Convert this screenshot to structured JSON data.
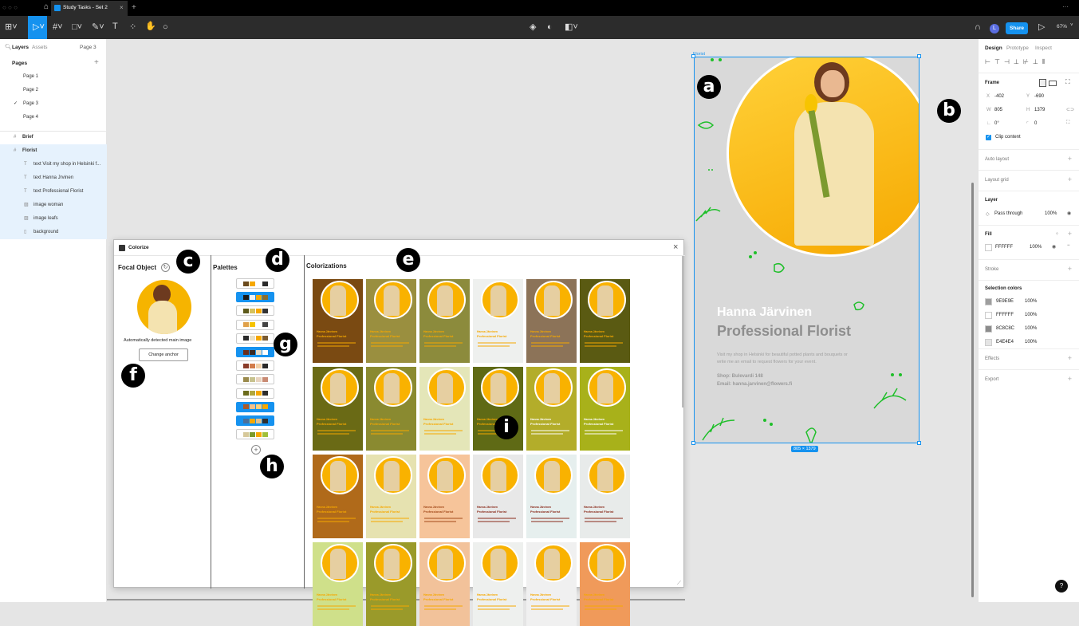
{
  "tabs": {
    "title": "Study Tasks - Set 2",
    "close": "×",
    "add": "+",
    "more": "···"
  },
  "toolbar": {
    "share": "Share",
    "zoom": "67%",
    "avatar": "L"
  },
  "left": {
    "tab_layers": "Layers",
    "tab_assets": "Assets",
    "page_select": "Page 3",
    "pages_title": "Pages",
    "pages": [
      "Page 1",
      "Page 2",
      "Page 3",
      "Page 4"
    ],
    "active_check": "✓",
    "layers": [
      {
        "name": "Brief",
        "icon": "#"
      },
      {
        "name": "Florist",
        "icon": "#"
      },
      {
        "name": "text Visit my shop in Helsinki f...",
        "icon": "T"
      },
      {
        "name": "text Hanna Jrvinen",
        "icon": "T"
      },
      {
        "name": "text Professional Florist",
        "icon": "T"
      },
      {
        "name": "image woman",
        "icon": "▨"
      },
      {
        "name": "image leafs",
        "icon": "▨"
      },
      {
        "name": "background",
        "icon": "▯"
      }
    ]
  },
  "canvas": {
    "frame_label": "Florist",
    "size_label": "805 × 1379",
    "name": "Hanna Järvinen",
    "profession": "Professional Florist",
    "body1": "Visit my shop in Helsinki for beautiful potted plants and bouquets or",
    "body2": "write me an email to request flowers for your event.",
    "shop": "Shop: Bulevardi 148",
    "email": "Email: hanna.jarvinen@flowers.fi"
  },
  "badges": {
    "a": "a",
    "b": "b",
    "c": "c",
    "d": "d",
    "e": "e",
    "f": "f",
    "g": "g",
    "h": "h",
    "i": "i"
  },
  "plugin": {
    "title": "Colorize",
    "close": "×",
    "focal_title": "Focal Object",
    "focal_caption": "Automatically detected main image",
    "change_anchor": "Change anchor",
    "palettes_title": "Palettes",
    "colorizations_title": "Colorizations",
    "add": "+",
    "mini_name": "Hanna Järvinen",
    "mini_prof": "Professional Florist"
  },
  "right": {
    "tab_design": "Design",
    "tab_prototype": "Prototype",
    "tab_inspect": "Inspect",
    "frame": "Frame",
    "x_label": "X",
    "x": "-402",
    "y_label": "Y",
    "y": "-690",
    "w_label": "W",
    "w": "805",
    "h_label": "H",
    "h": "1379",
    "rot": "0°",
    "radius": "0",
    "clip": "Clip content",
    "auto_layout": "Auto layout",
    "layout_grid": "Layout grid",
    "layer": "Layer",
    "pass_through": "Pass through",
    "layer_opacity": "100%",
    "fill": "Fill",
    "fill_hex": "FFFFFF",
    "fill_opacity": "100%",
    "stroke": "Stroke",
    "selection_colors": "Selection colors",
    "sel_colors": [
      {
        "hex": "9E9E9E",
        "op": "100%",
        "color": "#9e9e9e"
      },
      {
        "hex": "FFFFFF",
        "op": "100%",
        "color": "#ffffff"
      },
      {
        "hex": "8C8C8C",
        "op": "100%",
        "color": "#8c8c8c"
      },
      {
        "hex": "E4E4E4",
        "op": "100%",
        "color": "#e4e4e4"
      }
    ],
    "effects": "Effects",
    "export": "Export",
    "help": "?"
  },
  "palettes": [
    {
      "colors": [
        "#6b4a1c",
        "#f6a800",
        "#ffffff",
        "#2b2b2b"
      ],
      "active": false
    },
    {
      "colors": [
        "#1b1b1b",
        "#f2f2f2",
        "#f6a800",
        "#8a6d2f"
      ],
      "active": true
    },
    {
      "colors": [
        "#5d5a1b",
        "#d6c25d",
        "#f6a800",
        "#333333"
      ],
      "active": false
    },
    {
      "colors": [
        "#e0a14a",
        "#f6c300",
        "#ffffff",
        "#444444"
      ],
      "active": false
    },
    {
      "colors": [
        "#2b2b2b",
        "#e8e0c8",
        "#f6a800",
        "#7a5a30"
      ],
      "active": false
    },
    {
      "colors": [
        "#6a2e1c",
        "#3b2a24",
        "#e8dcc8",
        "#ffffff"
      ],
      "active": true
    },
    {
      "colors": [
        "#8b3d2a",
        "#d27c4b",
        "#f2d0a8",
        "#2a2a2a"
      ],
      "active": false
    },
    {
      "colors": [
        "#9a8a4c",
        "#c7c28f",
        "#e8d4c0",
        "#c98b74"
      ],
      "active": false
    },
    {
      "colors": [
        "#6b6b1c",
        "#b1a63c",
        "#f6a800",
        "#2d2d2d"
      ],
      "active": false
    },
    {
      "colors": [
        "#a85a2a",
        "#f3c08a",
        "#ffd07a",
        "#f6a800"
      ],
      "active": true
    },
    {
      "colors": [
        "#4a6f9a",
        "#f6a800",
        "#e3c18a",
        "#2f2f2f"
      ],
      "active": true
    },
    {
      "colors": [
        "#d6c89a",
        "#7a9a2a",
        "#f6a800",
        "#9fbf3a"
      ],
      "active": false
    }
  ],
  "thumbs": [
    {
      "bg": "#7a4a12",
      "t": "#f6a800"
    },
    {
      "bg": "#9a8f3f",
      "t": "#f6a800"
    },
    {
      "bg": "#8c8b3c",
      "t": "#f6a800"
    },
    {
      "bg": "#eef0ee",
      "t": "#f6a800"
    },
    {
      "bg": "#8c7358",
      "t": "#f6a800"
    },
    {
      "bg": "#5a5a12",
      "t": "#f6a800"
    },
    {
      "bg": "#6a6a15",
      "t": "#f6a800"
    },
    {
      "bg": "#8a8a30",
      "t": "#f6a800"
    },
    {
      "bg": "#e4e6b8",
      "t": "#f6a800"
    },
    {
      "bg": "#5f6a15",
      "t": "#f6a800"
    },
    {
      "bg": "#b3ad2a",
      "t": "#ffffff"
    },
    {
      "bg": "#a8b11a",
      "t": "#ffffff"
    },
    {
      "bg": "#b06a1a",
      "t": "#f6a800"
    },
    {
      "bg": "#e6e2b0",
      "t": "#f6a800"
    },
    {
      "bg": "#f6c49a",
      "t": "#a34a1a"
    },
    {
      "bg": "#e8e8e8",
      "t": "#8a2a1a"
    },
    {
      "bg": "#e6efee",
      "t": "#8a2a1a"
    },
    {
      "bg": "#e8ebea",
      "t": "#8a2a1a"
    },
    {
      "bg": "#cfe08a",
      "t": "#f6a800"
    },
    {
      "bg": "#9a9a2a",
      "t": "#f6a800"
    },
    {
      "bg": "#f2c29a",
      "t": "#f6a800"
    },
    {
      "bg": "#eef0ee",
      "t": "#f6a800"
    },
    {
      "bg": "#f0f0f0",
      "t": "#f6a800"
    },
    {
      "bg": "#f09a5a",
      "t": "#f6a800"
    }
  ]
}
